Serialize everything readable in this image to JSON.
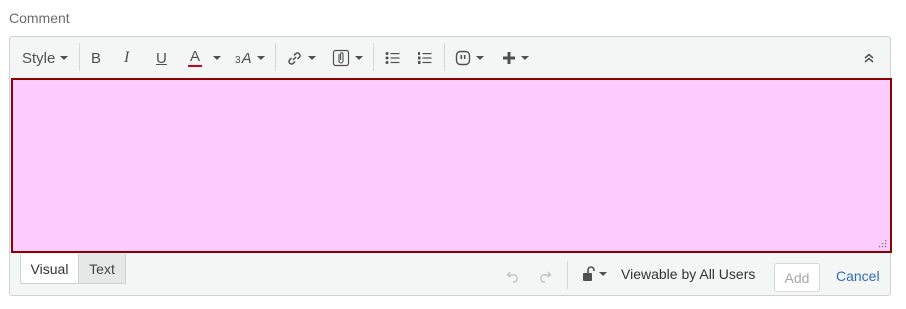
{
  "label": "Comment",
  "toolbar": {
    "style_label": "Style",
    "bold": "B",
    "italic": "I",
    "underline": "U",
    "text_color": "A",
    "font_size": "A",
    "font_size_prefix": "3",
    "text_color_underline": "#d0021b"
  },
  "footer": {
    "tabs": [
      {
        "label": "Visual",
        "active": true
      },
      {
        "label": "Text",
        "active": false
      }
    ],
    "visibility_label": "Viewable by All Users",
    "add_label": "Add",
    "cancel_label": "Cancel"
  },
  "colors": {
    "content_bg": "#ffccff",
    "content_border": "#8b0000",
    "link": "#2f6db5"
  }
}
